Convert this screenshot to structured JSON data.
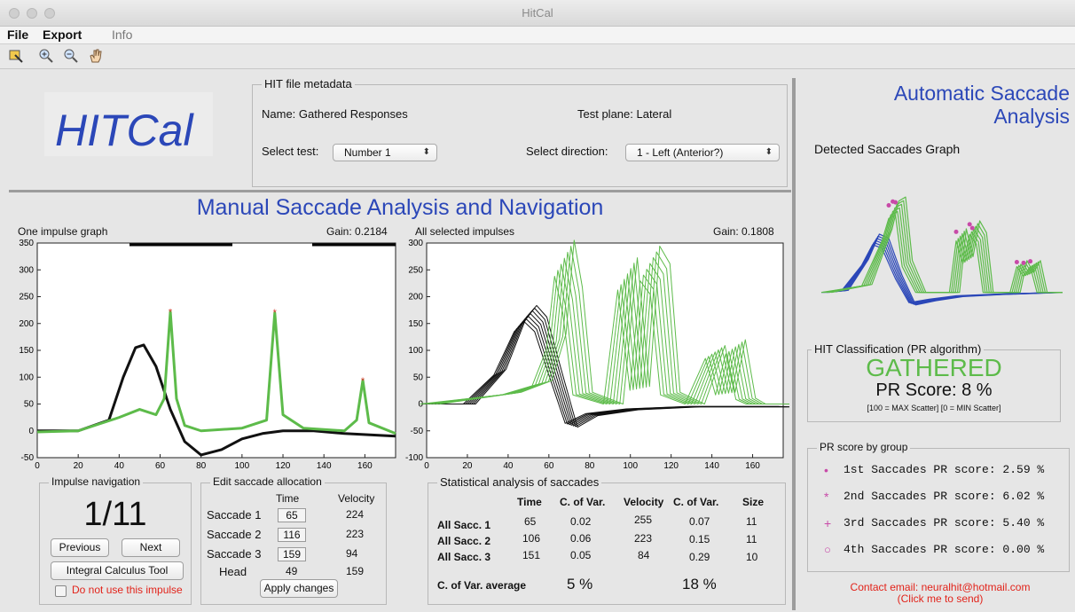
{
  "window": {
    "title": "HitCal"
  },
  "menu": {
    "file": "File",
    "export": "Export",
    "info": "Info"
  },
  "toolbar": {
    "icons": [
      "data-cursor-icon",
      "zoom-in-icon",
      "zoom-out-icon",
      "pan-hand-icon"
    ]
  },
  "app": {
    "logo": "HITCal"
  },
  "metadata": {
    "legend": "HIT file metadata",
    "name": "Name: Gathered Responses",
    "test_plane": "Test plane: Lateral",
    "select_test_label": "Select test:",
    "select_test_value": "Number 1",
    "select_direction_label": "Select direction:",
    "select_direction_value": "1 - Left (Anterior?)"
  },
  "manual": {
    "title": "Manual Saccade Analysis and Navigation",
    "one_graph_label": "One impulse graph",
    "one_graph_gain": "Gain: 0.2184",
    "all_graph_label": "All selected impulses",
    "all_graph_gain": "Gain: 0.1808"
  },
  "navigation": {
    "legend": "Impulse navigation",
    "counter": "1/11",
    "previous": "Previous",
    "next": "Next",
    "integral": "Integral Calculus Tool",
    "do_not_use": "Do not use this impulse"
  },
  "edit": {
    "legend": "Edit saccade allocation",
    "col_time": "Time",
    "col_velocity": "Velocity",
    "rows": [
      {
        "label": "Saccade 1",
        "time": "65",
        "velocity": "224"
      },
      {
        "label": "Saccade 2",
        "time": "116",
        "velocity": "223"
      },
      {
        "label": "Saccade 3",
        "time": "159",
        "velocity": "94"
      },
      {
        "label": "Head",
        "time": "49",
        "velocity": "159"
      }
    ],
    "apply": "Apply changes"
  },
  "stats": {
    "legend": "Statistical analysis of saccades",
    "headers": [
      "Time",
      "C. of Var.",
      "Velocity",
      "C. of Var.",
      "Size"
    ],
    "rows": [
      {
        "label": "All Sacc. 1",
        "cells": [
          "65",
          "0.02",
          "255",
          "0.07",
          "11"
        ]
      },
      {
        "label": "All Sacc. 2",
        "cells": [
          "106",
          "0.06",
          "223",
          "0.15",
          "11"
        ]
      },
      {
        "label": "All Sacc. 3",
        "cells": [
          "151",
          "0.05",
          "84",
          "0.29",
          "10"
        ]
      }
    ],
    "cov_label": "C. of Var. average",
    "cov_time": "5 %",
    "cov_velocity": "18 %"
  },
  "automatic": {
    "title_line1": "Automatic Saccade",
    "title_line2": "Analysis",
    "detected_label": "Detected Saccades Graph",
    "classification_legend": "HIT Classification (PR algorithm)",
    "classification": "GATHERED",
    "pr_score": "PR Score: 8 %",
    "scatter_note": "[100 = MAX Scatter] [0 = MIN Scatter]",
    "group_legend": "PR score by group",
    "groups": [
      {
        "marker": "•",
        "text": "1st Saccades PR score: 2.59 %"
      },
      {
        "marker": "*",
        "text": "2nd Saccades PR score: 6.02 %"
      },
      {
        "marker": "+",
        "text": "3rd Saccades PR score: 5.40 %"
      },
      {
        "marker": "○",
        "text": "4th Saccades PR score: 0.00 %"
      }
    ],
    "contact_line1": "Contact email: neuralhit@hotmail.com",
    "contact_line2": "(Click me to send)"
  },
  "colors": {
    "accent_blue": "#2b47b8",
    "saccade_green": "#5dbb4a",
    "head_black": "#111111",
    "marker_red": "#d23a2a",
    "pr_magenta": "#c84aa8",
    "alert_red": "#e2231a"
  },
  "chart_data": [
    {
      "type": "line",
      "title": "One impulse graph",
      "xlim": [
        0,
        175
      ],
      "ylim": [
        -50,
        350
      ],
      "xticks": [
        0,
        20,
        40,
        60,
        80,
        100,
        120,
        140,
        160
      ],
      "yticks": [
        -50,
        0,
        50,
        100,
        150,
        200,
        250,
        300,
        350
      ],
      "series": [
        {
          "color": "#111111",
          "x": [
            0,
            20,
            35,
            42,
            48,
            52,
            58,
            65,
            72,
            80,
            90,
            100,
            110,
            120,
            135,
            150,
            175
          ],
          "y": [
            0,
            0,
            20,
            100,
            155,
            160,
            120,
            40,
            -20,
            -45,
            -35,
            -15,
            -5,
            0,
            0,
            -5,
            -10
          ]
        },
        {
          "color": "#5dbb4a",
          "x": [
            0,
            20,
            40,
            50,
            58,
            62,
            65,
            68,
            72,
            80,
            100,
            112,
            116,
            120,
            130,
            150,
            156,
            159,
            162,
            175
          ],
          "y": [
            -2,
            0,
            25,
            40,
            30,
            60,
            222,
            60,
            10,
            0,
            5,
            20,
            220,
            30,
            5,
            0,
            20,
            94,
            15,
            -5
          ]
        }
      ],
      "markers": [
        {
          "x": 65,
          "y": 222
        },
        {
          "x": 116,
          "y": 221
        },
        {
          "x": 159,
          "y": 94
        }
      ]
    },
    {
      "type": "line",
      "title": "All selected impulses",
      "xlim": [
        0,
        175
      ],
      "ylim": [
        -100,
        300
      ],
      "xticks": [
        0,
        20,
        40,
        60,
        80,
        100,
        120,
        140,
        160
      ],
      "yticks": [
        -100,
        -50,
        0,
        50,
        100,
        150,
        200,
        250,
        300
      ],
      "series": [
        {
          "color": "#111111",
          "x": [
            0,
            20,
            35,
            45,
            50,
            55,
            62,
            70,
            80,
            100,
            130,
            175
          ],
          "y": [
            0,
            0,
            60,
            150,
            170,
            150,
            60,
            -40,
            -20,
            -10,
            -5,
            -5
          ]
        },
        {
          "color": "#5dbb4a",
          "x": [
            0,
            40,
            55,
            62,
            66,
            70,
            75,
            90,
            97,
            103,
            108,
            113,
            118,
            130,
            140,
            145,
            150,
            155,
            160,
            175
          ],
          "y": [
            0,
            20,
            40,
            120,
            280,
            200,
            20,
            0,
            250,
            30,
            270,
            240,
            20,
            0,
            100,
            20,
            110,
            10,
            0,
            0
          ]
        }
      ]
    },
    {
      "type": "line",
      "title": "Detected Saccades Graph",
      "series": [
        {
          "color": "#2b47b8",
          "x": [
            0,
            15,
            30,
            38,
            45,
            55,
            65,
            80,
            100,
            130,
            175
          ],
          "y": [
            0,
            5,
            80,
            140,
            130,
            40,
            -30,
            -20,
            -10,
            -5,
            0
          ]
        },
        {
          "color": "#5dbb4a",
          "x": [
            0,
            30,
            45,
            50,
            55,
            60,
            70,
            95,
            100,
            105,
            110,
            115,
            120,
            140,
            145,
            150,
            155,
            160,
            175
          ],
          "y": [
            0,
            20,
            160,
            230,
            240,
            80,
            0,
            0,
            160,
            90,
            180,
            150,
            0,
            0,
            80,
            50,
            80,
            0,
            0
          ]
        }
      ]
    }
  ]
}
